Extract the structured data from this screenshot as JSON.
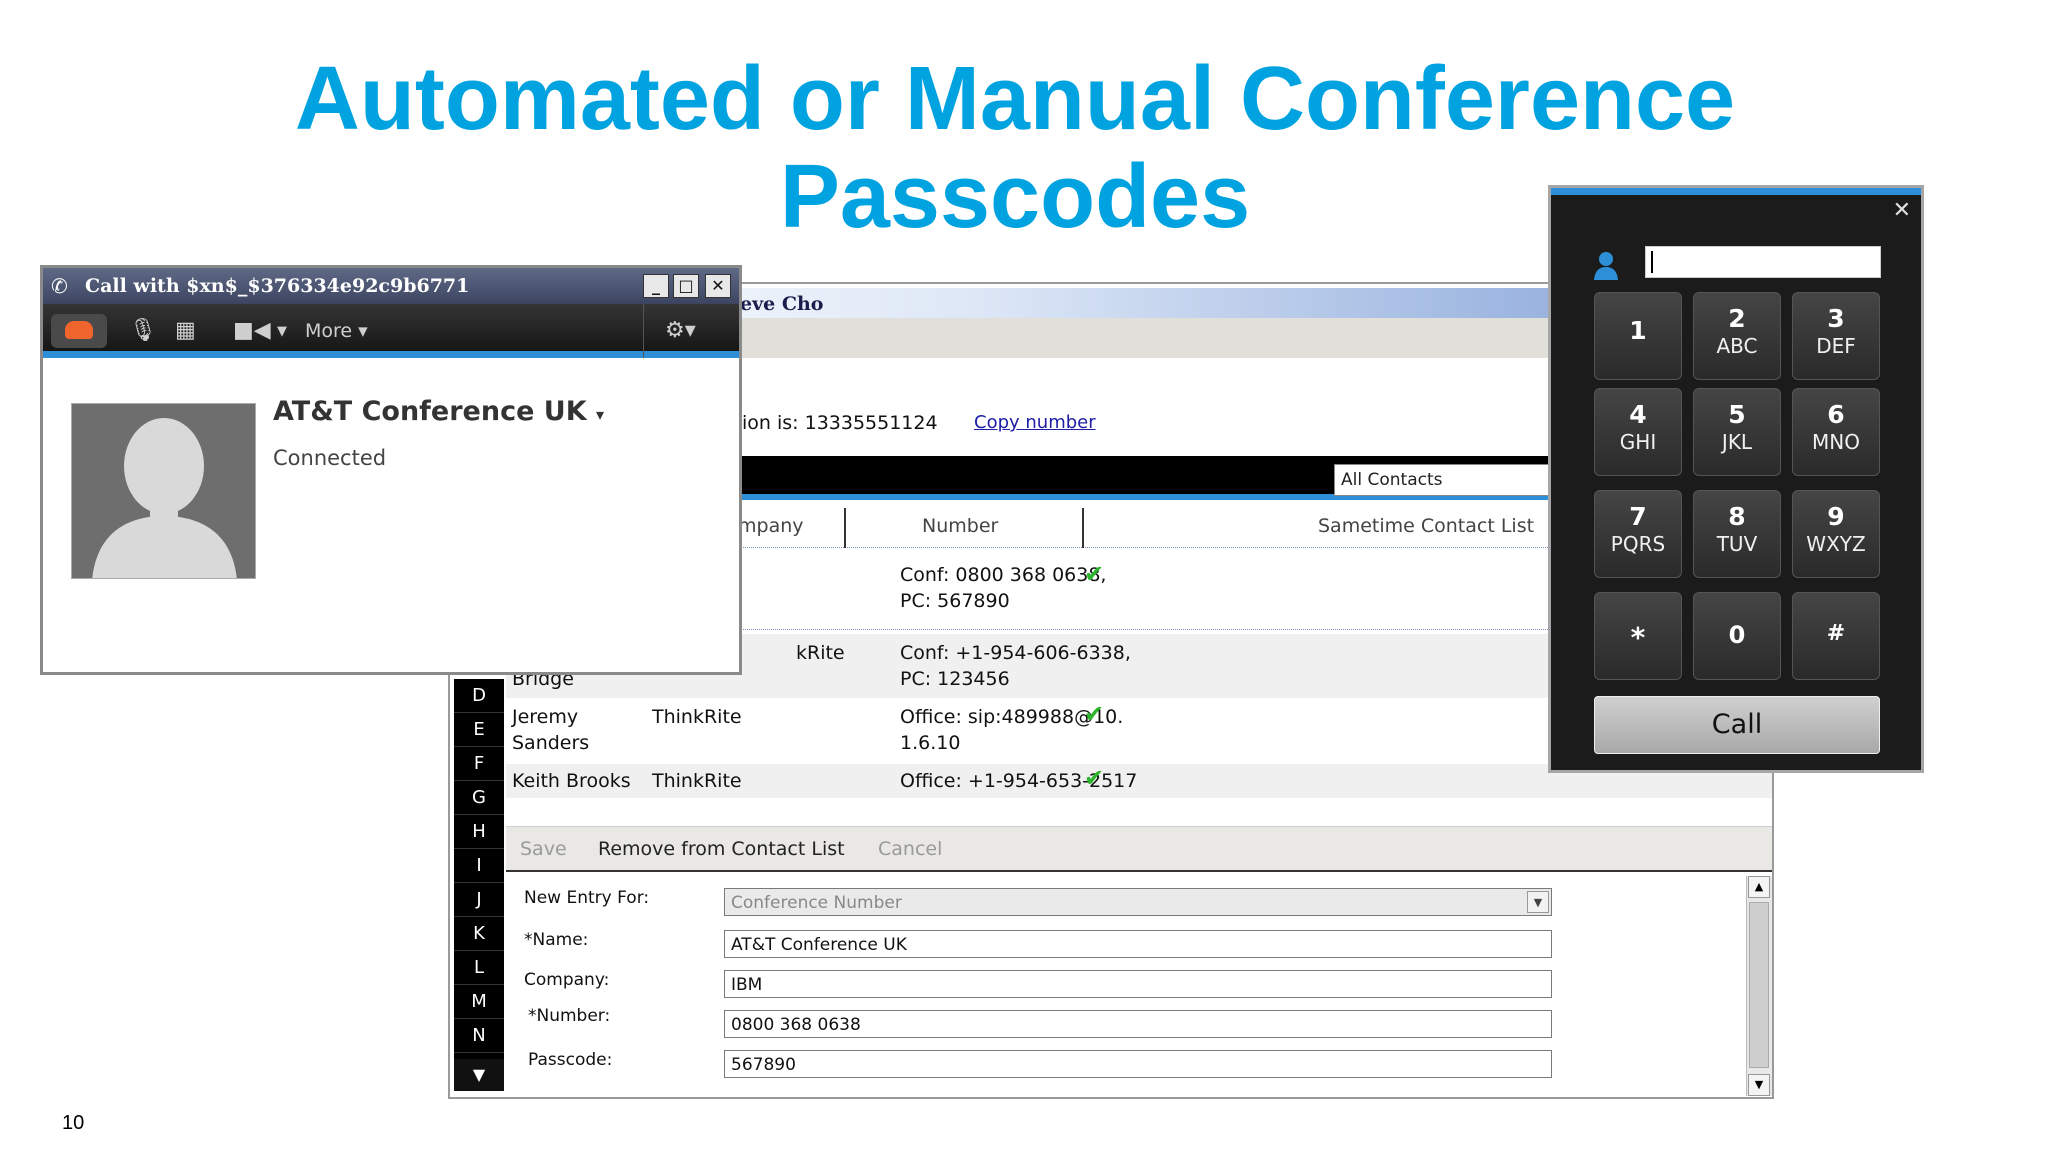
{
  "slide": {
    "title_line1": "Automated or Manual Conference",
    "title_line2": "Passcodes",
    "page_number": "10"
  },
  "contact_window": {
    "title_fragment": "eve Cho",
    "call_info": "ion is: 13335551124",
    "copy_link": "Copy number",
    "filter_value": "All Contacts",
    "headers": {
      "company": "mpany",
      "number": "Number",
      "sametime": "Sametime Contact List"
    },
    "alphabet": [
      "D",
      "E",
      "F",
      "G",
      "H",
      "I",
      "J",
      "K",
      "L",
      "M",
      "N"
    ],
    "rows": [
      {
        "name": "",
        "company": "",
        "number_line1": "Conf: 0800 368 0638,",
        "number_line2": "PC: 567890",
        "online": true
      },
      {
        "name": "Bridge",
        "company": "kRite",
        "number_line1": "Conf: +1-954-606-6338,",
        "number_line2": "PC: 123456",
        "online": false
      },
      {
        "name_line1": "Jeremy",
        "name_line2": "Sanders",
        "company": "ThinkRite",
        "number_line1": "Office: sip:489988@10.",
        "number_line2": "1.6.10",
        "online": true
      },
      {
        "name": "Keith Brooks",
        "company": "ThinkRite",
        "number_line1": "Office: +1-954-653-2517",
        "online": true
      }
    ],
    "actions": {
      "save": "Save",
      "remove": "Remove from Contact List",
      "cancel": "Cancel"
    },
    "form": {
      "new_entry_label": "New Entry For:",
      "new_entry_value": "Conference Number",
      "name_label": "*Name:",
      "name_value": "AT&T Conference UK",
      "company_label": "Company:",
      "company_value": "IBM",
      "number_label": "*Number:",
      "number_value": "0800 368 0638",
      "passcode_label": "Passcode:",
      "passcode_value": "567890"
    }
  },
  "call_window": {
    "title": "Call with $xn$_$376334e92c9b6771",
    "more_label": "More",
    "contact_name": "AT&T Conference UK",
    "status": "Connected"
  },
  "dialpad": {
    "keys": [
      {
        "digit": "1",
        "letters": ""
      },
      {
        "digit": "2",
        "letters": "ABC"
      },
      {
        "digit": "3",
        "letters": "DEF"
      },
      {
        "digit": "4",
        "letters": "GHI"
      },
      {
        "digit": "5",
        "letters": "JKL"
      },
      {
        "digit": "6",
        "letters": "MNO"
      },
      {
        "digit": "7",
        "letters": "PQRS"
      },
      {
        "digit": "8",
        "letters": "TUV"
      },
      {
        "digit": "9",
        "letters": "WXYZ"
      },
      {
        "digit": "*",
        "letters": ""
      },
      {
        "digit": "0",
        "letters": ""
      },
      {
        "digit": "#",
        "letters": ""
      }
    ],
    "call_label": "Call",
    "input_value": ""
  },
  "colors": {
    "title": "#00a3e0",
    "accent_blue": "#2d8fd8",
    "hangup_orange": "#f0642d",
    "online_green": "#2cb52c"
  }
}
